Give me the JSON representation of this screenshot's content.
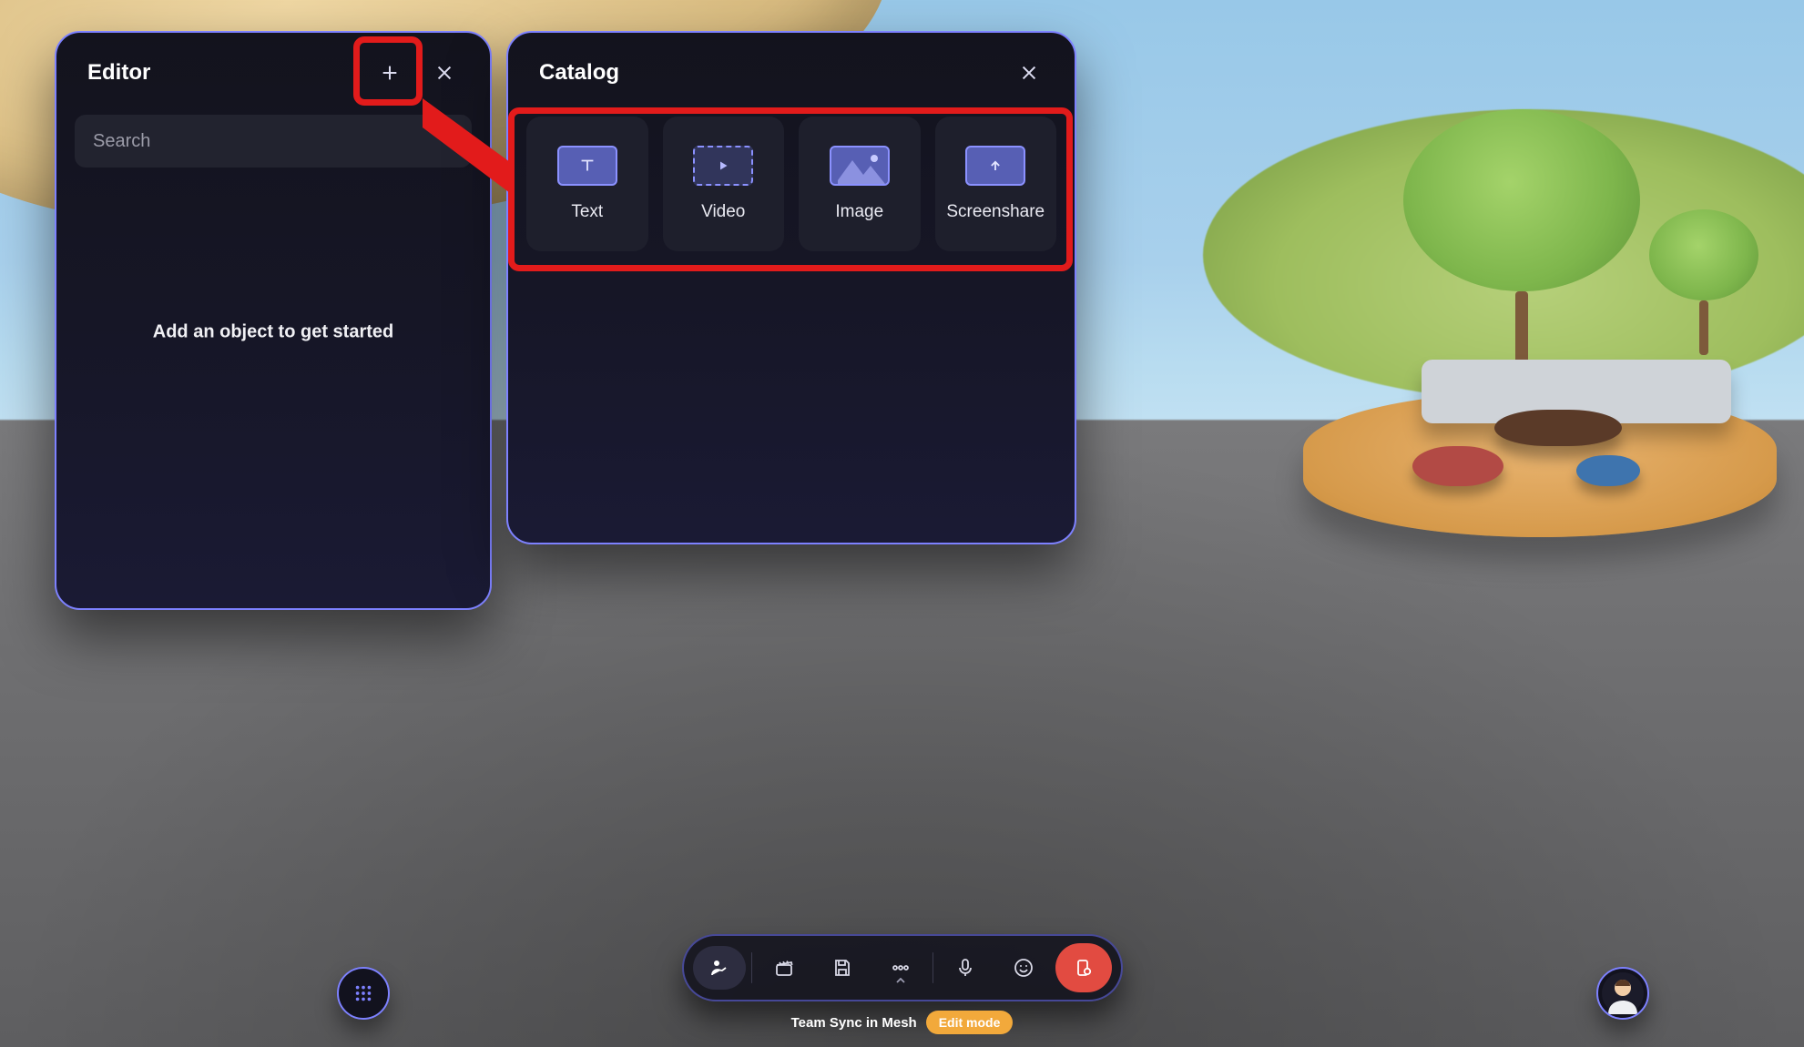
{
  "editor": {
    "title": "Editor",
    "search_placeholder": "Search",
    "empty_message": "Add an object to get started"
  },
  "catalog": {
    "title": "Catalog",
    "items": [
      {
        "label": "Text",
        "icon": "text-icon"
      },
      {
        "label": "Video",
        "icon": "video-icon"
      },
      {
        "label": "Image",
        "icon": "image-icon"
      },
      {
        "label": "Screenshare",
        "icon": "screenshare-icon"
      }
    ]
  },
  "hud": {
    "buttons": [
      {
        "name": "avatar-pose-button",
        "icon": "avatar-pose-icon",
        "active": true
      },
      {
        "name": "clapper-button",
        "icon": "clapper-icon"
      },
      {
        "name": "save-button",
        "icon": "save-icon"
      },
      {
        "name": "more-button",
        "icon": "more-icon",
        "caret": true
      },
      {
        "name": "mic-button",
        "icon": "mic-icon"
      },
      {
        "name": "reactions-button",
        "icon": "smile-icon"
      },
      {
        "name": "leave-button",
        "icon": "leave-icon",
        "danger": true
      }
    ]
  },
  "status": {
    "session_name": "Team Sync in Mesh",
    "mode_label": "Edit mode"
  },
  "colors": {
    "panel_border": "#7d81ff",
    "annotation": "#e21b1b",
    "danger": "#e24b41",
    "badge": "#f2a93b",
    "tile_accent": "#575fb4"
  }
}
